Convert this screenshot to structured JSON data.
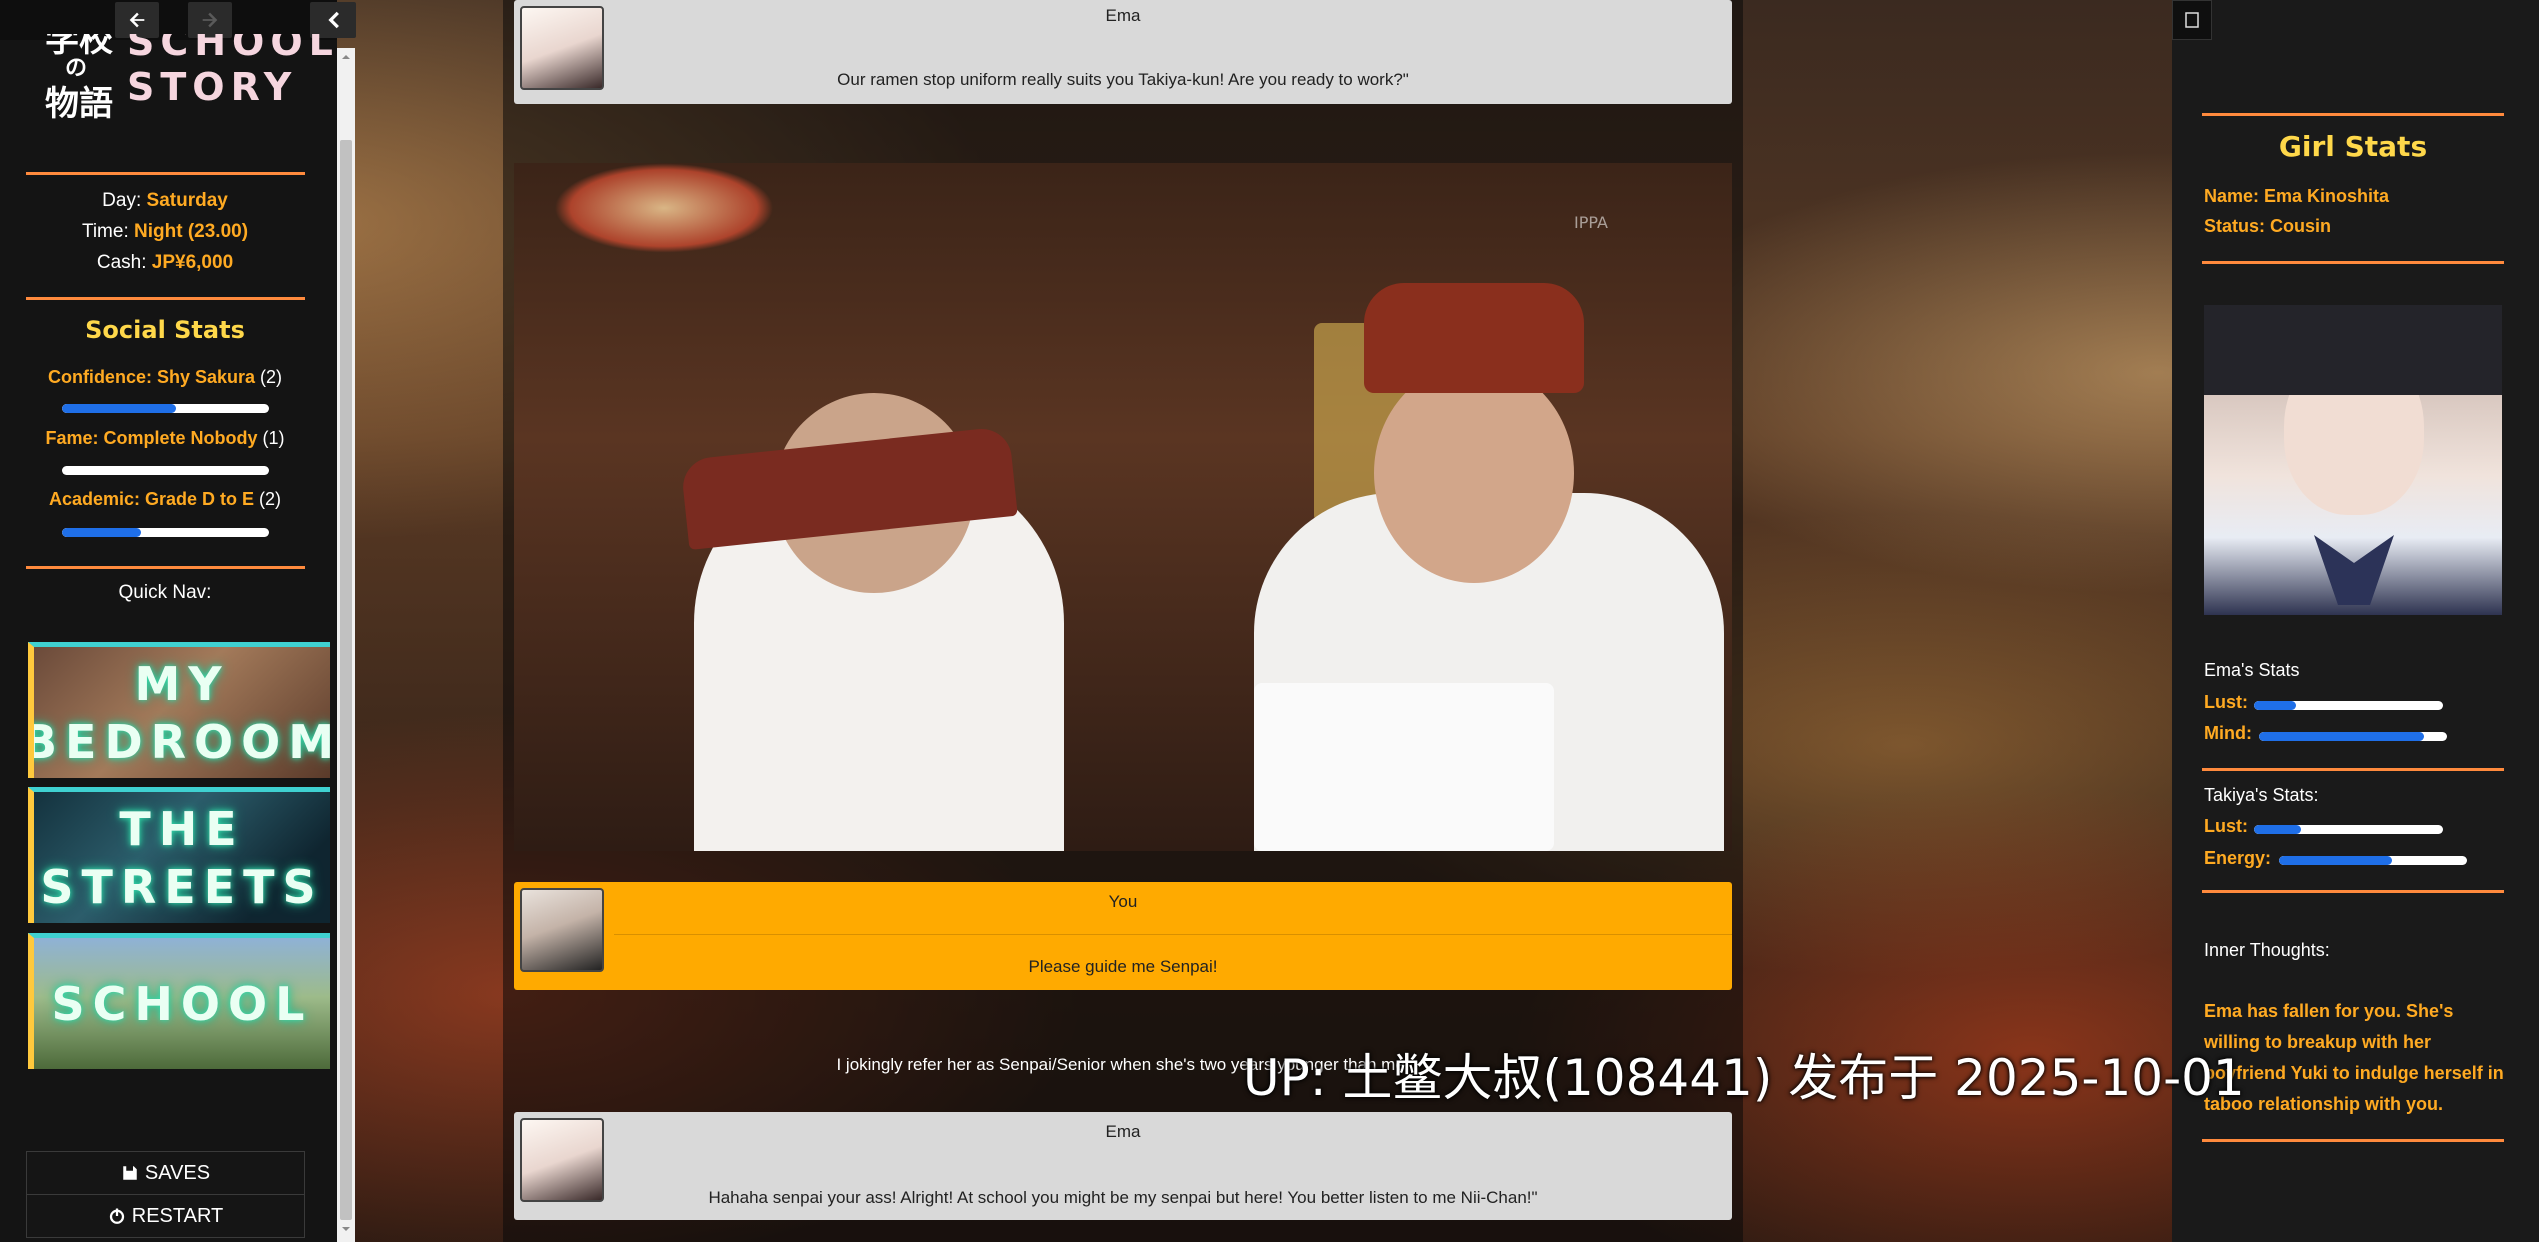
{
  "nav": {
    "back_icon": "arrow-left-icon",
    "forward_icon": "arrow-right-icon",
    "collapse_icon": "chevron-left-icon"
  },
  "logo": {
    "jp_line1": "学校",
    "jp_line2": "の",
    "jp_line3": "物語",
    "en_line1": "SCHOOL",
    "en_line2": "STORY"
  },
  "status": {
    "day_label": "Day:",
    "day_value": "Saturday",
    "time_label": "Time:",
    "time_value": "Night (23.00)",
    "cash_label": "Cash:",
    "cash_value": "JP¥6,000"
  },
  "social_stats": {
    "title": "Social Stats",
    "confidence": {
      "label": "Confidence: Shy Sakura",
      "level": "(2)",
      "progress": 0.55
    },
    "fame": {
      "label": "Fame: Complete Nobody",
      "level": "(1)",
      "progress": 0.0
    },
    "academic": {
      "label": "Academic: Grade D to E",
      "level": "(2)",
      "progress": 0.38
    }
  },
  "quick_nav": {
    "title": "Quick Nav:",
    "items": [
      {
        "label_line1": "MY",
        "label_line2": "BEDROOM"
      },
      {
        "label_line1": "THE",
        "label_line2": "STREETS"
      },
      {
        "label_line1": "SCHOOL",
        "label_line2": ""
      }
    ]
  },
  "buttons": {
    "saves": "SAVES",
    "restart": "RESTART"
  },
  "dialog": [
    {
      "speaker": "Ema",
      "text": "Our ramen stop uniform really suits you Takiya-kun! Are you ready to work?\""
    },
    {
      "speaker": "You",
      "text": "Please guide me Senpai!"
    },
    {
      "speaker": "Ema",
      "text": "Hahaha senpai your ass! Alright! At school you might be my senpai but here! You better listen to me Nii-Chan!\""
    }
  ],
  "narration": "I jokingly refer her as Senpai/Senior when she's two years younger than me.",
  "scene_watermark": "IPPA",
  "girl_stats": {
    "title": "Girl Stats",
    "name_label": "Name: Ema Kinoshita",
    "status_label": "Status: Cousin",
    "ema_stats_title": "Ema's Stats",
    "lust_label": "Lust:",
    "lust_progress": 0.22,
    "mind_label": "Mind:",
    "mind_progress": 0.88,
    "takiya_stats_title": "Takiya's Stats:",
    "t_lust_label": "Lust:",
    "t_lust_progress": 0.25,
    "energy_label": "Energy:",
    "energy_progress": 0.6,
    "thoughts_title": "Inner Thoughts:",
    "thoughts_text": "Ema has fallen for you. She's willing to breakup with her boyfriend Yuki to indulge herself in taboo relationship with you."
  },
  "overlay": {
    "watermark": "UP: 土鳖大叔(108441) 发布于 2025-10-01"
  },
  "colors": {
    "accent_orange": "#ffaa22",
    "title_yellow": "#ffd84a",
    "divider_orange": "#ff8a3d",
    "bar_fill": "#1f6fe8",
    "dialog_player": "#ffaa00",
    "dialog_npc": "#d9d9d9"
  }
}
